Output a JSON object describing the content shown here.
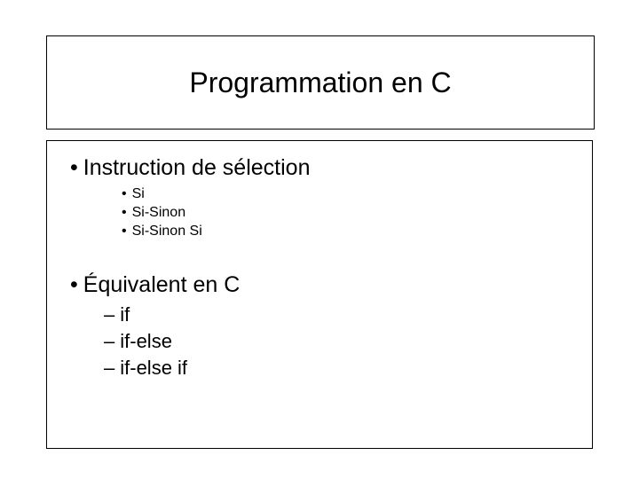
{
  "title": "Programmation en C",
  "section1": {
    "heading": "Instruction de sélection",
    "items": [
      "Si",
      "Si-Sinon",
      "Si-Sinon Si"
    ]
  },
  "section2": {
    "heading": "Équivalent en C",
    "items": [
      "if",
      "if-else",
      "if-else if"
    ]
  },
  "bullets": {
    "dot": "•",
    "dash": "–"
  }
}
